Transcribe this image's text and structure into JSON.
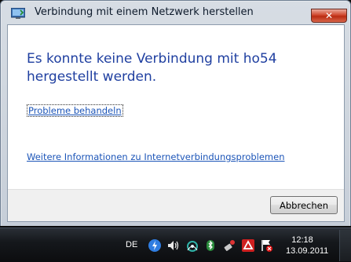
{
  "window": {
    "title": "Verbindung mit einem Netzwerk herstellen",
    "headline": "Es konnte keine Verbindung mit ho54 hergestellt werden.",
    "troubleshoot_link": "Probleme behandeln",
    "more_info_link": "Weitere Informationen zu Internetverbindungsproblemen",
    "cancel_label": "Abbrechen"
  },
  "taskbar": {
    "language": "DE",
    "time": "12:18",
    "date": "13.09.2011",
    "tray_icons": [
      "power-icon",
      "volume-icon",
      "network-icon",
      "bluetooth-icon",
      "usb-device-icon",
      "antivirus-icon",
      "action-center-flag-icon"
    ]
  },
  "colors": {
    "headline": "#1f3fa0",
    "link": "#1c55b8",
    "taskbar": "#15181c"
  }
}
